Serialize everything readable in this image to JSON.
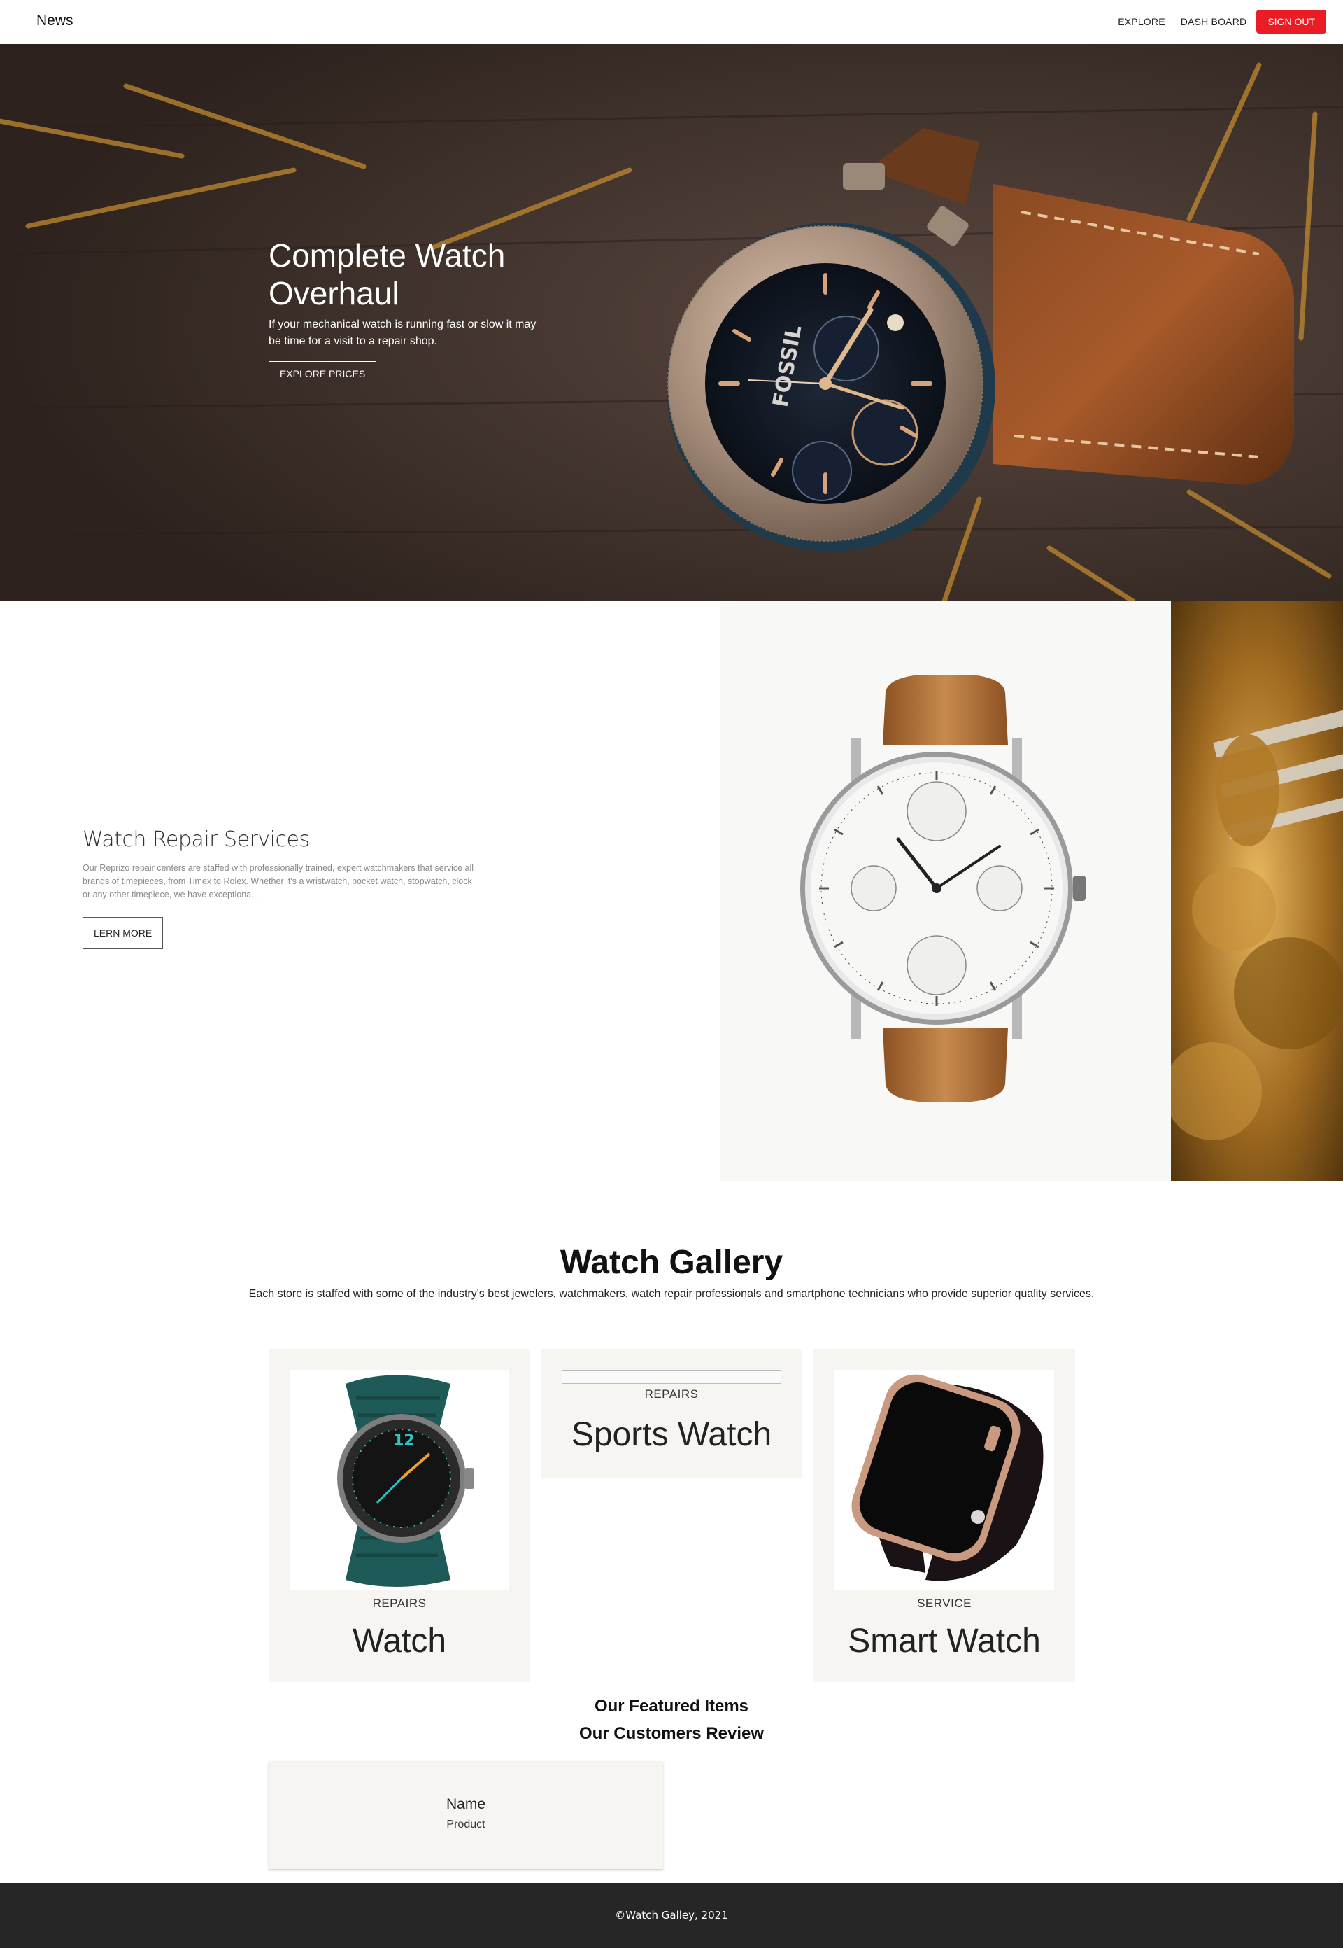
{
  "navbar": {
    "brand": "News",
    "links": [
      "EXPLORE",
      "DASH BOARD"
    ],
    "signout_label": "SIGN OUT",
    "signout_color": "#ec1c24"
  },
  "hero": {
    "title": "Complete Watch Overhaul",
    "description": "If your mechanical watch is running fast or slow it may be time for a visit to a repair shop.",
    "button_label": "EXPLORE PRICES",
    "watch_brand_text": "FOSSIL"
  },
  "services": {
    "title": "Watch Repair Services",
    "description": "Our Reprizo repair centers are staffed with professionally trained, expert watchmakers that service all brands of timepieces, from Timex to Rolex. Whether it's a wristwatch, pocket watch, stopwatch, clock or any other timepiece, we have exceptiona...",
    "button_label": "LERN MORE"
  },
  "gallery": {
    "title": "Watch Gallery",
    "subtitle": "Each store is staffed with some of the industry's best jewelers, watchmakers, watch repair professionals and smartphone technicians who provide superior quality services.",
    "cards": [
      {
        "category": "REPAIRS",
        "title": "Watch",
        "icon": "smartwatch-green-strap-image"
      },
      {
        "category": "REPAIRS",
        "title": "Sports Watch",
        "icon": "broken-image-icon"
      },
      {
        "category": "SERVICE",
        "title": "Smart Watch",
        "icon": "apple-watch-image"
      }
    ]
  },
  "featured_heading": "Our Featured Items",
  "reviews": {
    "heading": "Our Customers Review",
    "items": [
      {
        "name": "Name",
        "product": "Product"
      }
    ]
  },
  "footer": {
    "text": "©Watch Galley, 2021"
  }
}
